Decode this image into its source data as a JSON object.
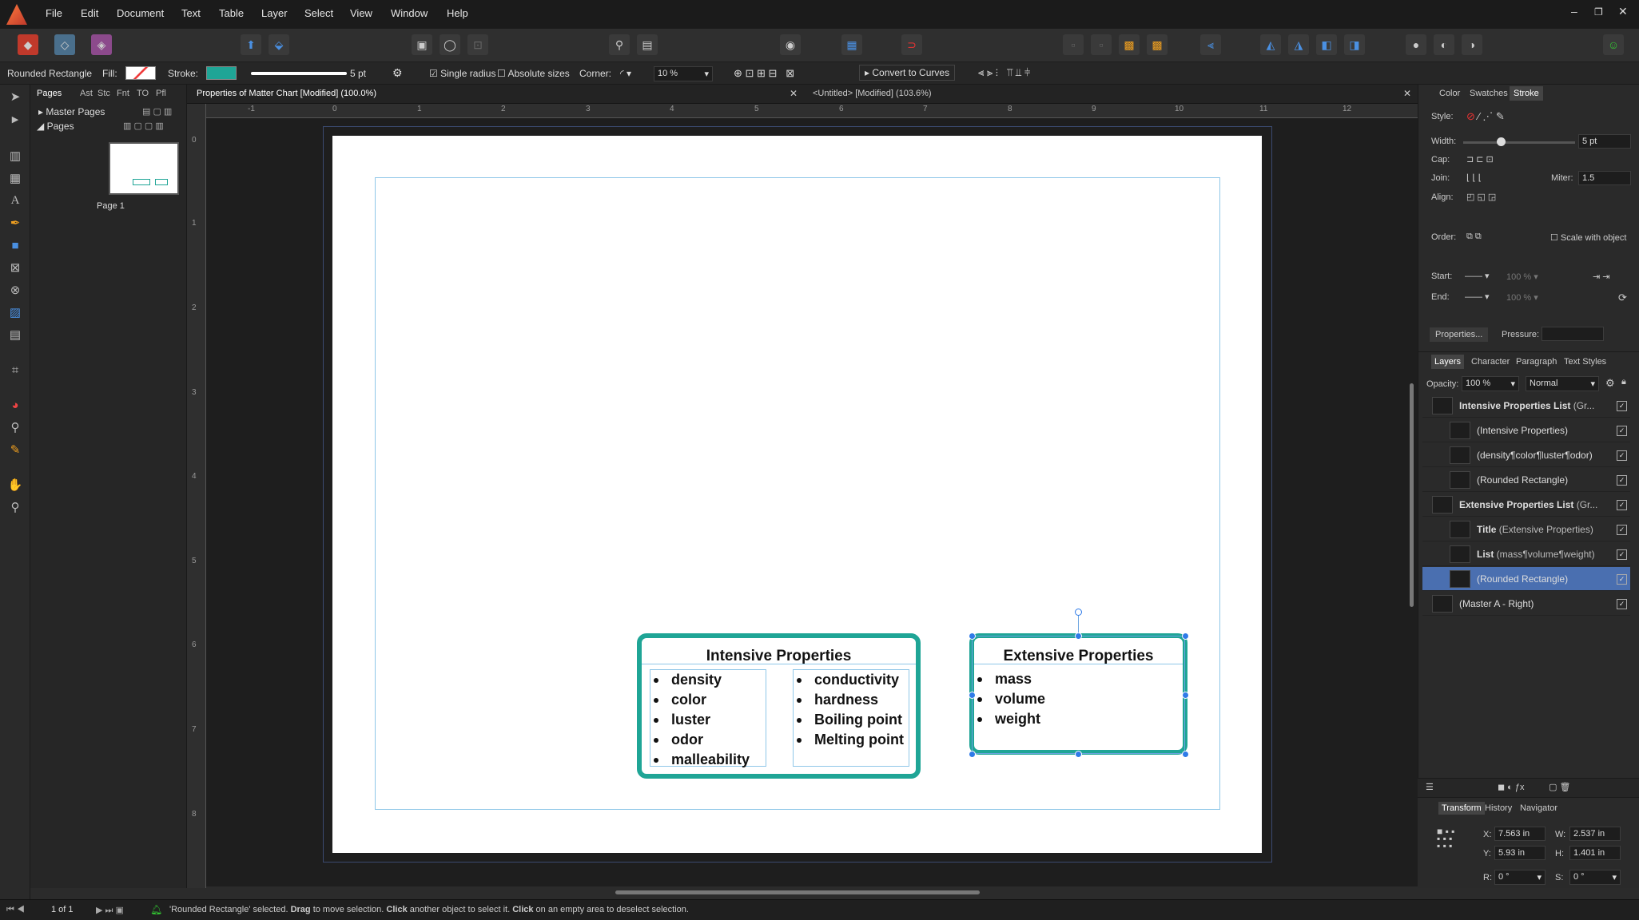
{
  "menubar": {
    "items": [
      "File",
      "Edit",
      "Document",
      "Text",
      "Table",
      "Layer",
      "Select",
      "View",
      "Window",
      "Help"
    ]
  },
  "context": {
    "object_type": "Rounded Rectangle",
    "fill_label": "Fill:",
    "stroke_label": "Stroke:",
    "stroke_width": "5 pt",
    "single_radius": "Single radius",
    "absolute_sizes": "Absolute sizes",
    "corner_label": "Corner:",
    "corner_value": "10 %",
    "convert": "Convert to Curves",
    "stroke_color": "#1fa596"
  },
  "pages_panel": {
    "tabs": [
      "Pages",
      "Ast",
      "Stc",
      "Fnt",
      "TO",
      "Pfl"
    ],
    "master_pages": "Master Pages",
    "pages": "Pages",
    "page1": "Page 1"
  },
  "doc_tabs": [
    {
      "label": "Properties of Matter Chart [Modified] (100.0%)"
    },
    {
      "label": "<Untitled> [Modified] (103.6%)"
    }
  ],
  "ruler": {
    "top_ticks": [
      "-1",
      "0",
      "1",
      "2",
      "3",
      "4",
      "5",
      "6",
      "7",
      "8",
      "9",
      "10",
      "11",
      "12"
    ],
    "left_ticks": [
      "0",
      "1",
      "2",
      "3",
      "4",
      "5",
      "6",
      "7",
      "8"
    ]
  },
  "document": {
    "intensive": {
      "title": "Intensive Properties",
      "col1": [
        "density",
        "color",
        "luster",
        "odor",
        "malleability"
      ],
      "col2": [
        "conductivity",
        "hardness",
        "Boiling point",
        "Melting point"
      ]
    },
    "extensive": {
      "title": "Extensive Properties",
      "items": [
        "mass",
        "volume",
        "weight"
      ]
    }
  },
  "stroke_panel": {
    "tabs": [
      "Color",
      "Swatches",
      "Stroke"
    ],
    "style": "Style:",
    "width_label": "Width:",
    "width_value": "5 pt",
    "cap": "Cap:",
    "join": "Join:",
    "miter_label": "Miter:",
    "miter_value": "1.5",
    "align": "Align:",
    "order": "Order:",
    "scale_with_object": "Scale with object",
    "start": "Start:",
    "end": "End:",
    "start_pct": "100 %",
    "end_pct": "100 %",
    "properties": "Properties...",
    "pressure": "Pressure:"
  },
  "layers_panel": {
    "tabs": [
      "Layers",
      "Character",
      "Paragraph",
      "Text Styles"
    ],
    "opacity_label": "Opacity:",
    "opacity_value": "100 %",
    "blend": "Normal",
    "rows": [
      {
        "label": "Intensive Properties List",
        "suffix": " (Gr...",
        "bold": true,
        "indent": 0
      },
      {
        "label": "",
        "suffix": "(Intensive Properties)",
        "bold": false,
        "indent": 1
      },
      {
        "label": "",
        "suffix": "(density¶color¶luster¶odor)",
        "bold": false,
        "indent": 1
      },
      {
        "label": "",
        "suffix": "(Rounded Rectangle)",
        "bold": false,
        "indent": 1
      },
      {
        "label": "Extensive Properties List",
        "suffix": " (Gr...",
        "bold": true,
        "indent": 0
      },
      {
        "label": "Title",
        "suffix": " (Extensive Properties)",
        "bold": true,
        "indent": 1
      },
      {
        "label": "List",
        "suffix": " (mass¶volume¶weight)",
        "bold": true,
        "indent": 1
      },
      {
        "label": "",
        "suffix": "(Rounded Rectangle)",
        "bold": false,
        "indent": 1,
        "selected": true
      },
      {
        "label": "",
        "suffix": "(Master A - Right)",
        "bold": false,
        "indent": 0
      }
    ]
  },
  "transform_panel": {
    "tabs": [
      "Transform",
      "History",
      "Navigator"
    ],
    "x_label": "X:",
    "x": "7.563 in",
    "y_label": "Y:",
    "y": "5.93 in",
    "w_label": "W:",
    "w": "2.537 in",
    "h_label": "H:",
    "h": "1.401 in",
    "r_label": "R:",
    "r": "0 °",
    "s_label": "S:",
    "s": "0 °"
  },
  "status": {
    "page_count": "1 of 1",
    "message_start": "'Rounded Rectangle' selected. ",
    "drag": "Drag",
    "m1": " to move selection. ",
    "click": "Click",
    "m2": " another object to select it. ",
    "click2": "Click",
    "m3": " on an empty area to deselect selection."
  }
}
